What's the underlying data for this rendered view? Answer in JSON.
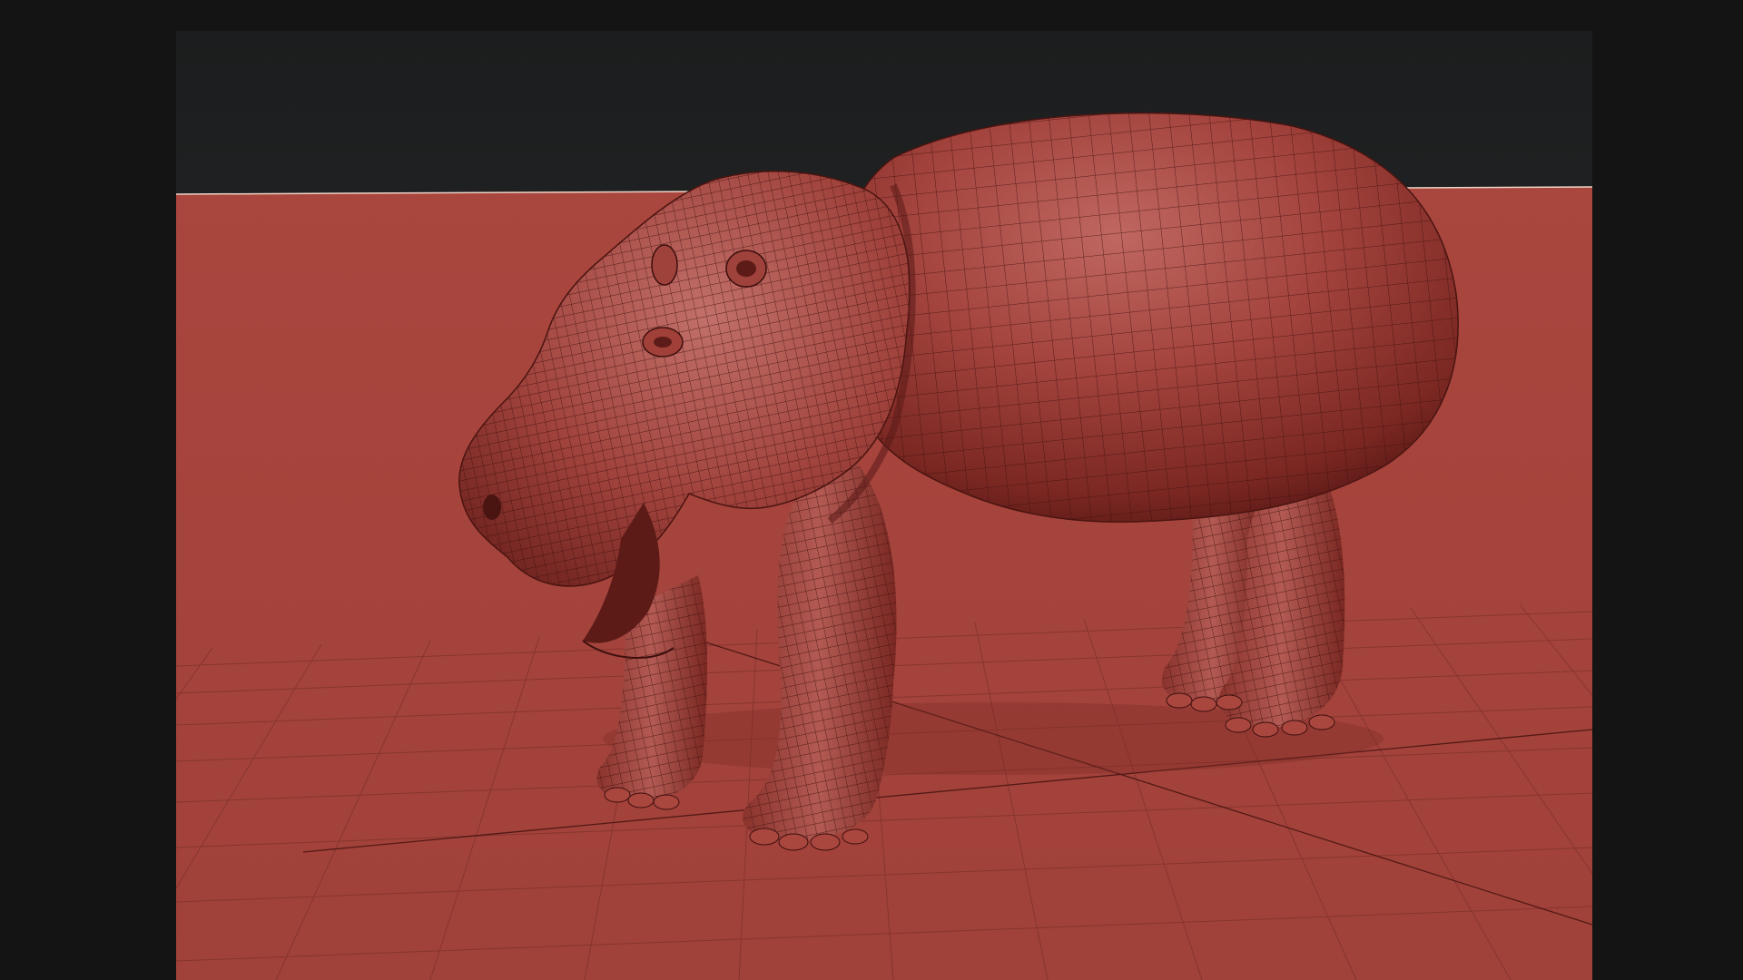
{
  "scene": {
    "subject": "hippo-model",
    "colors": {
      "frame_bg": "#141414",
      "sky_top": "#1c1d1e",
      "sky_bottom": "#2a2c2d",
      "floor": "#a9463e",
      "floor_grid": "#7c3029",
      "model_base": "#9a3a34",
      "model_highlight": "#c46a62",
      "model_shadow": "#5a1a17",
      "wire": "#3d0f0d"
    }
  }
}
